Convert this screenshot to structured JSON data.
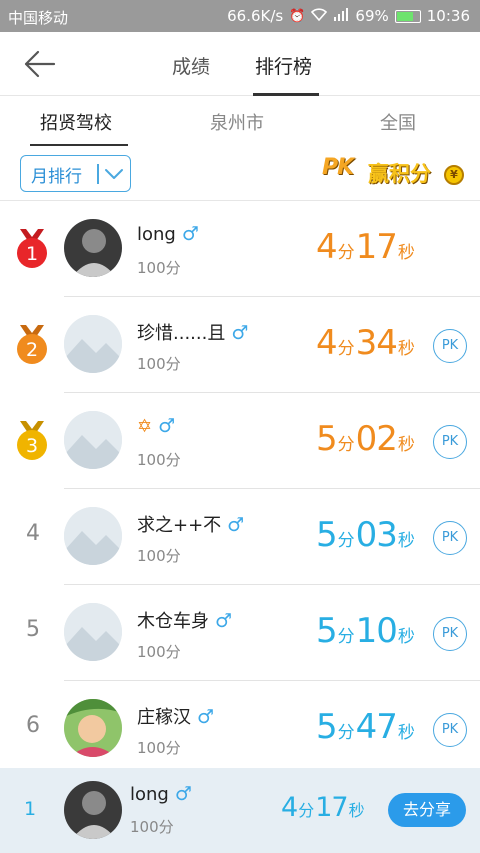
{
  "statusbar": {
    "carrier": "中国移动",
    "speed": "66.6K/s",
    "signal": "26",
    "battery": "69%",
    "time": "10:36"
  },
  "header": {
    "tabs": [
      {
        "label": "成绩"
      },
      {
        "label": "排行榜"
      }
    ]
  },
  "subtabs": [
    {
      "label": "招贤驾校"
    },
    {
      "label": "泉州市"
    },
    {
      "label": "全国"
    }
  ],
  "filter": {
    "label": "月排行"
  },
  "pk_banner": {
    "pk": "PK",
    "text": "赢积分",
    "coin": "¥"
  },
  "rows": [
    {
      "rank": "1",
      "name": "long",
      "gender": "♂",
      "points": "100分",
      "min": "4",
      "sec": "17",
      "min_unit": "分",
      "sec_unit": "秒"
    },
    {
      "rank": "2",
      "name": "珍惜......且",
      "gender": "♂",
      "points": "100分",
      "min": "4",
      "sec": "34",
      "min_unit": "分",
      "sec_unit": "秒",
      "pk": "PK"
    },
    {
      "rank": "3",
      "name": "✡",
      "gender": "♂",
      "points": "100分",
      "min": "5",
      "sec": "02",
      "min_unit": "分",
      "sec_unit": "秒",
      "pk": "PK"
    },
    {
      "rank": "4",
      "name": "求之++不",
      "gender": "♂",
      "points": "100分",
      "min": "5",
      "sec": "03",
      "min_unit": "分",
      "sec_unit": "秒",
      "pk": "PK"
    },
    {
      "rank": "5",
      "name": "木仓车身",
      "gender": "♂",
      "points": "100分",
      "min": "5",
      "sec": "10",
      "min_unit": "分",
      "sec_unit": "秒",
      "pk": "PK"
    },
    {
      "rank": "6",
      "name": "庄稼汉",
      "gender": "♂",
      "points": "100分",
      "min": "5",
      "sec": "47",
      "min_unit": "分",
      "sec_unit": "秒",
      "pk": "PK"
    }
  ],
  "my_rank": {
    "rank": "1",
    "name": "long",
    "gender": "♂",
    "points": "100分",
    "min": "4",
    "sec": "17",
    "min_unit": "分",
    "sec_unit": "秒",
    "share": "去分享"
  },
  "colors": {
    "medal_gold": "#f0b400",
    "medal_red": "#e8262a",
    "medal_orange": "#f08b1e",
    "time_orange": "#f08b1e",
    "time_blue": "#28aee3",
    "accent": "#2b9bea"
  }
}
